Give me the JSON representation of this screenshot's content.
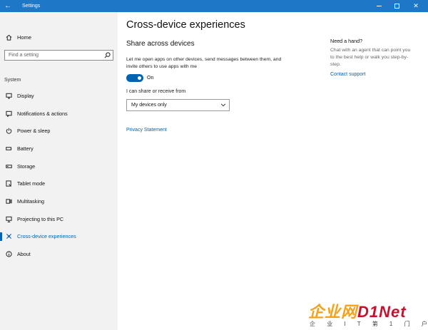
{
  "window": {
    "title": "Settings"
  },
  "titlebar": {
    "back_icon": "back-arrow-icon",
    "controls": [
      "minimize-icon",
      "maximize-icon",
      "close-icon"
    ]
  },
  "sidebar": {
    "home_label": "Home",
    "search": {
      "placeholder": "Find a setting"
    },
    "section_title": "System",
    "items": [
      {
        "label": "Display",
        "icon": "monitor-icon",
        "active": false
      },
      {
        "label": "Notifications & actions",
        "icon": "notifications-icon",
        "active": false
      },
      {
        "label": "Power & sleep",
        "icon": "power-icon",
        "active": false
      },
      {
        "label": "Battery",
        "icon": "battery-icon",
        "active": false
      },
      {
        "label": "Storage",
        "icon": "storage-icon",
        "active": false
      },
      {
        "label": "Tablet mode",
        "icon": "tablet-mode-icon",
        "active": false
      },
      {
        "label": "Multitasking",
        "icon": "multitasking-icon",
        "active": false
      },
      {
        "label": "Projecting to this PC",
        "icon": "projecting-icon",
        "active": false
      },
      {
        "label": "Cross-device experiences",
        "icon": "cross-device-icon",
        "active": true
      },
      {
        "label": "About",
        "icon": "info-icon",
        "active": false
      }
    ]
  },
  "main": {
    "title": "Cross-device experiences",
    "subtitle": "Share across devices",
    "description": "Let me open apps on other devices, send messages between them, and invite others to use apps with me",
    "toggle": {
      "state_label": "On",
      "on": true
    },
    "share_label": "I can share or receive from",
    "dropdown": {
      "value": "My devices only"
    },
    "privacy_link": "Privacy Statement"
  },
  "help": {
    "title": "Need a hand?",
    "body": "Chat with an agent that can point you to the best help or walk you step-by-step.",
    "link": "Contact support"
  },
  "watermark": {
    "main_a": "企业网",
    "main_b": "D1Net",
    "sub": "企 业 I T 第 1 门 户"
  },
  "colors": {
    "titlebar": "#1f77c8",
    "accent": "#0063b1",
    "sidebar_bg": "#f2f2f2"
  }
}
